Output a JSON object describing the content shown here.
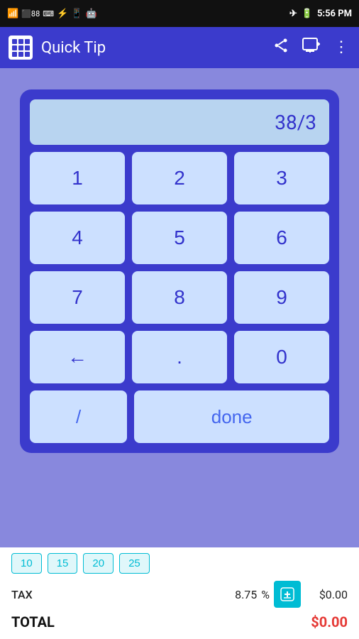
{
  "statusBar": {
    "time": "5:56 PM",
    "batteryIcon": "🔋",
    "icons": [
      "📶",
      "✈",
      "🔋"
    ]
  },
  "appBar": {
    "title": "Quick Tip",
    "shareIcon": "share",
    "addIcon": "add-to-photos",
    "menuIcon": "more-vert"
  },
  "calculator": {
    "display": "38/3",
    "keys": [
      "1",
      "2",
      "3",
      "4",
      "5",
      "6",
      "7",
      "8",
      "9",
      "←",
      ".",
      "0"
    ],
    "divideKey": "/",
    "doneKey": "done"
  },
  "tipButtons": {
    "options": [
      "10",
      "15",
      "20",
      "25"
    ]
  },
  "tax": {
    "label": "TAX",
    "value": "8.75",
    "percentSign": "%",
    "amount": "$0.00"
  },
  "total": {
    "label": "TOTAL",
    "amount": "$0.00"
  }
}
